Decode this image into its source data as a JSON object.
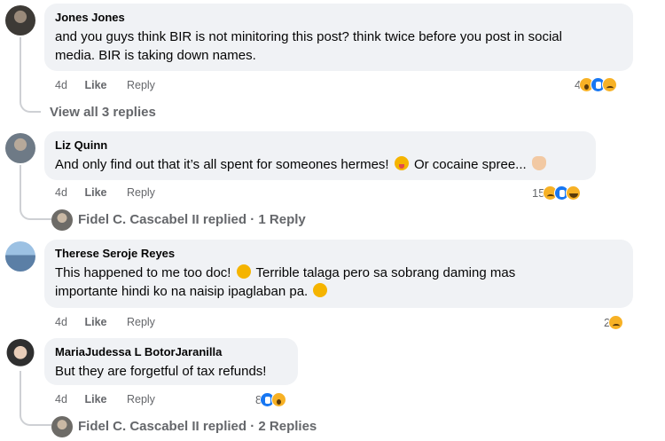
{
  "comments": [
    {
      "author": "Jones Jones",
      "text_line1": "and you guys think BIR is not minitoring this post? think twice before you post in social",
      "text_line2": "media. BIR is taking down names.",
      "age": "4d",
      "like_label": "Like",
      "reply_label": "Reply",
      "reaction_count": "4",
      "reactions": [
        "wow",
        "like",
        "sad"
      ],
      "replies_link": "View all 3 replies",
      "avatar_color": "#3d3a36"
    },
    {
      "author": "Liz Quinn",
      "text_line1": "And only find out that it’s all spent for someones hermes!",
      "text_line1b": "Or cocaine spree...",
      "age": "4d",
      "like_label": "Like",
      "reply_label": "Reply",
      "reaction_count": "15",
      "reactions": [
        "sad",
        "like",
        "haha"
      ],
      "replies_link": "Fidel C. Cascabel II replied · 1 Reply",
      "avatar_color": "#6e7a86"
    },
    {
      "author": "Therese Seroje Reyes",
      "text_line1": "This happened to me too doc!",
      "text_line1b": "Terrible talaga pero sa sobrang daming mas",
      "text_line2": "importante hindi ko na naisip ipaglaban pa.",
      "age": "4d",
      "like_label": "Like",
      "reply_label": "Reply",
      "reaction_count": "2",
      "reactions": [
        "sad"
      ],
      "avatar_color": "#5b7fa6"
    },
    {
      "author": "MariaJudessa L BotorJaranilla",
      "text_line1": "But they are forgetful of tax refunds!",
      "age": "4d",
      "like_label": "Like",
      "reply_label": "Reply",
      "reaction_count": "8",
      "reactions": [
        "like",
        "wow"
      ],
      "replies_link": "Fidel C. Cascabel II replied · 2 Replies",
      "avatar_color": "#2f2f2f"
    }
  ],
  "colors": {
    "bubble_bg": "#f0f2f5",
    "meta_text": "#65676b",
    "like_blue": "#1877f2",
    "emoji_yellow": "#f7b125"
  }
}
